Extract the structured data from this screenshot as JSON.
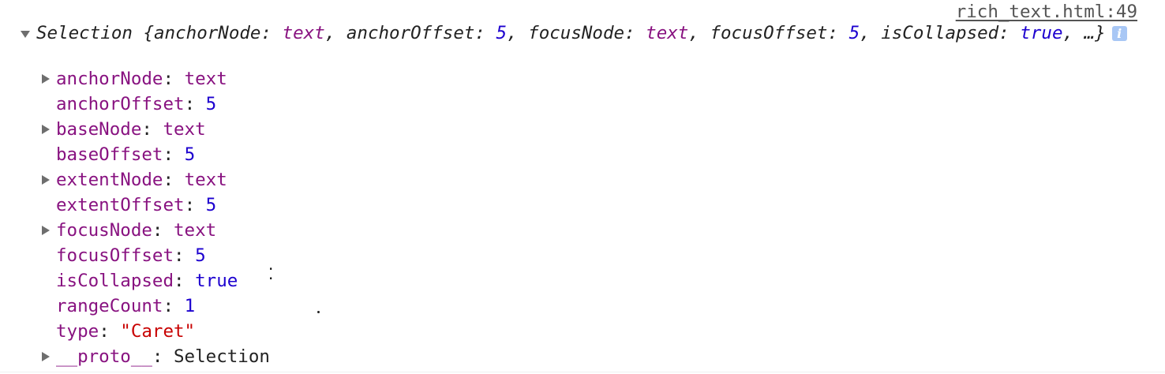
{
  "source_link": "rich_text.html:49",
  "summary": {
    "type_name": "Selection",
    "open_brace": " {",
    "k1": "anchorNode",
    "v1": "text",
    "k2": "anchorOffset",
    "v2": "5",
    "k3": "focusNode",
    "v3": "text",
    "k4": "focusOffset",
    "v4": "5",
    "k5": "isCollapsed",
    "v5": "true",
    "tail": ", …}",
    "info_glyph": "i"
  },
  "properties": [
    {
      "key": "anchorNode",
      "value": "text",
      "value_kind": "node",
      "expandable": true
    },
    {
      "key": "anchorOffset",
      "value": "5",
      "value_kind": "num",
      "expandable": false
    },
    {
      "key": "baseNode",
      "value": "text",
      "value_kind": "node",
      "expandable": true
    },
    {
      "key": "baseOffset",
      "value": "5",
      "value_kind": "num",
      "expandable": false
    },
    {
      "key": "extentNode",
      "value": "text",
      "value_kind": "node",
      "expandable": true
    },
    {
      "key": "extentOffset",
      "value": "5",
      "value_kind": "num",
      "expandable": false
    },
    {
      "key": "focusNode",
      "value": "text",
      "value_kind": "node",
      "expandable": true
    },
    {
      "key": "focusOffset",
      "value": "5",
      "value_kind": "num",
      "expandable": false
    },
    {
      "key": "isCollapsed",
      "value": "true",
      "value_kind": "bool",
      "expandable": false
    },
    {
      "key": "rangeCount",
      "value": "1",
      "value_kind": "num",
      "expandable": false
    },
    {
      "key": "type",
      "value": "\"Caret\"",
      "value_kind": "str",
      "expandable": false
    },
    {
      "key": "__proto__",
      "value": "Selection",
      "value_kind": "plain",
      "expandable": true
    }
  ],
  "separator": ": ",
  "colors": {
    "key": "#881280",
    "number": "#1c00cf",
    "string": "#c80000",
    "link": "#545454",
    "info_badge": "#a8c7f5"
  },
  "icons": {
    "expand_main": "triangle-down-icon",
    "expand_prop": "triangle-right-icon",
    "info": "info-icon"
  }
}
